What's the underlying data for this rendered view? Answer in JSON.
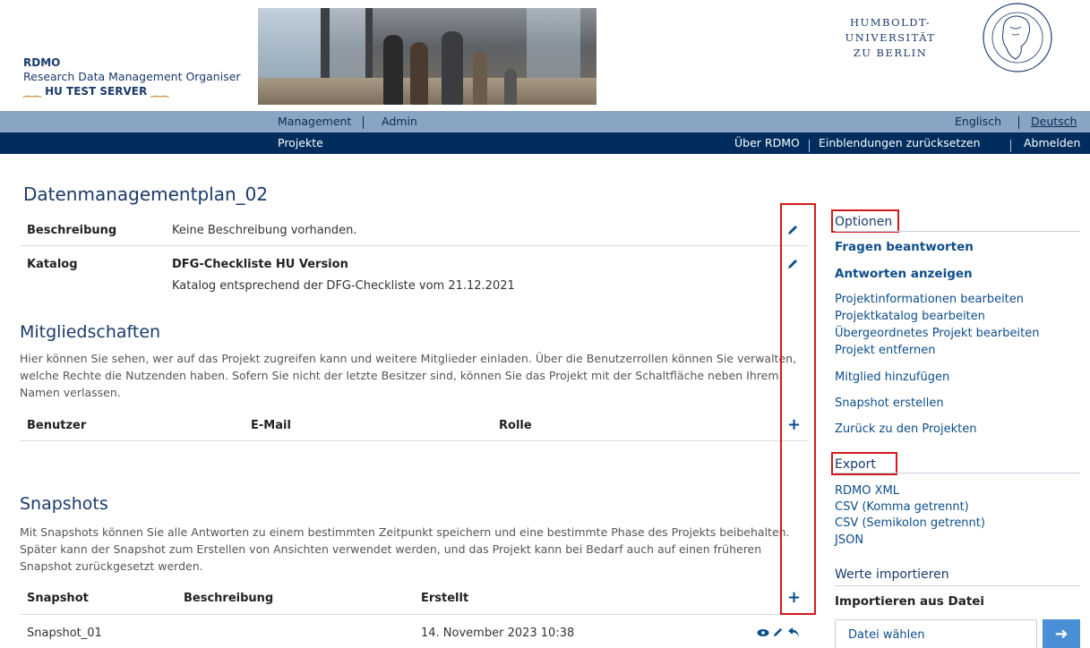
{
  "brand": {
    "title": "RDMO",
    "subtitle": "Research Data Management Organiser",
    "server": "HU TEST SERVER",
    "server_ornament": "⁔⁔",
    "university_line1": "HUMBOLDT-",
    "university_line2": "UNIVERSITÄT",
    "university_line3": "ZU BERLIN"
  },
  "topnav": {
    "management": "Management",
    "admin": "Admin",
    "englisch": "Englisch",
    "deutsch": "Deutsch"
  },
  "subnav": {
    "projekte": "Projekte",
    "ueber": "Über RDMO",
    "einblendungen": "Einblendungen zurücksetzen",
    "abmelden": "Abmelden"
  },
  "project": {
    "title": "Datenmanagementplan_02",
    "beschreibung_label": "Beschreibung",
    "beschreibung_value": "Keine Beschreibung vorhanden.",
    "katalog_label": "Katalog",
    "katalog_name": "DFG-Checkliste HU Version",
    "katalog_desc": "Katalog entsprechend der DFG-Checkliste vom 21.12.2021"
  },
  "members": {
    "heading": "Mitgliedschaften",
    "text": "Hier können Sie sehen, wer auf das Projekt zugreifen kann und weitere Mitglieder einladen. Über die Benutzerrollen können Sie verwalten, welche Rechte die Nutzenden haben. Sofern Sie nicht der letzte Besitzer sind, können Sie das Projekt mit der Schaltfläche neben Ihrem Namen verlassen.",
    "col_user": "Benutzer",
    "col_email": "E-Mail",
    "col_role": "Rolle"
  },
  "snapshots": {
    "heading": "Snapshots",
    "text": "Mit Snapshots können Sie alle Antworten zu einem bestimmten Zeitpunkt speichern und eine bestimmte Phase des Projekts beibehalten. Später kann der Snapshot zum Erstellen von Ansichten verwendet werden, und das Projekt kann bei Bedarf auch auf einen früheren Snapshot zurückgesetzt werden.",
    "col_snapshot": "Snapshot",
    "col_desc": "Beschreibung",
    "col_created": "Erstellt",
    "rows": [
      {
        "name": "Snapshot_01",
        "desc": "",
        "created": "14. November 2023 10:38"
      }
    ]
  },
  "sidebar": {
    "options_heading": "Optionen",
    "fragen": "Fragen beantworten",
    "antworten": "Antworten anzeigen",
    "projinfo": "Projektinformationen bearbeiten",
    "projkatalog": "Projektkatalog bearbeiten",
    "parent": "Übergeordnetes Projekt bearbeiten",
    "remove": "Projekt entfernen",
    "add_member": "Mitglied hinzufügen",
    "snapshot": "Snapshot erstellen",
    "back": "Zurück zu den Projekten",
    "export_heading": "Export",
    "export_items": [
      "RDMO XML",
      "CSV (Komma getrennt)",
      "CSV (Semikolon getrennt)",
      "JSON"
    ],
    "import_heading": "Werte importieren",
    "import_file": "Importieren aus Datei",
    "file_button": "Datei wählen"
  },
  "colors": {
    "navy": "#002d5e",
    "nav_light": "#8aa4c4",
    "link": "#0d4d8a",
    "highlight": "#d31a1a"
  }
}
